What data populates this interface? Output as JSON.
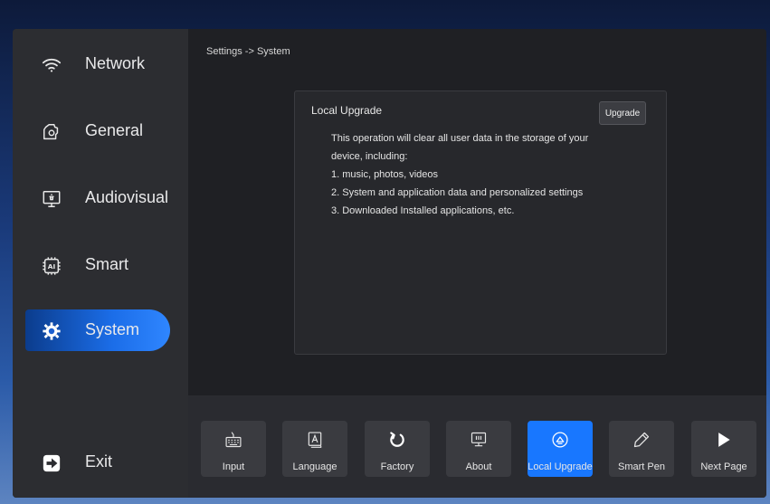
{
  "sidebar": {
    "items": [
      {
        "label": "Network",
        "icon": "wifi-icon"
      },
      {
        "label": "General",
        "icon": "gear-outline-icon"
      },
      {
        "label": "Audiovisual",
        "icon": "monitor-icon"
      },
      {
        "label": "Smart",
        "icon": "ai-chip-icon"
      },
      {
        "label": "System",
        "icon": "system-gear-icon",
        "active": true
      }
    ],
    "exit_label": "Exit"
  },
  "breadcrumb": "Settings -> System",
  "panel": {
    "title": "Local Upgrade",
    "button_label": "Upgrade",
    "lines": [
      "This operation will clear all user data in the storage of your",
      "device, including:",
      "1. music, photos, videos",
      "2. System and application data and personalized settings",
      "3. Downloaded Installed applications, etc."
    ]
  },
  "toolbar": {
    "tiles": [
      {
        "label": "Input",
        "icon": "keyboard-icon"
      },
      {
        "label": "Language",
        "icon": "language-icon"
      },
      {
        "label": "Factory",
        "icon": "refresh-icon"
      },
      {
        "label": "About",
        "icon": "about-monitor-icon"
      },
      {
        "label": "Local Upgrade",
        "icon": "upgrade-icon",
        "active": true
      },
      {
        "label": "Smart Pen",
        "icon": "pen-icon"
      },
      {
        "label": "Next Page",
        "icon": "play-icon"
      }
    ]
  },
  "colors": {
    "accent": "#1877ff",
    "sidebar_bg": "#2c2d31",
    "content_bg": "#1f2024"
  }
}
